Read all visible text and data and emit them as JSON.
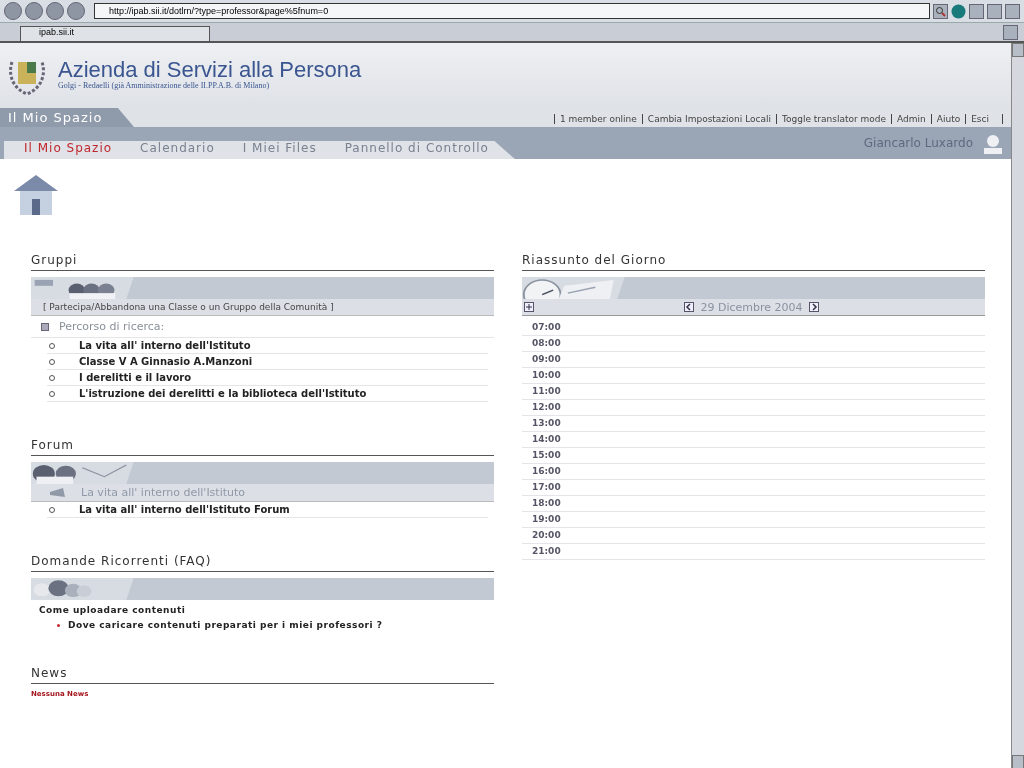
{
  "browser": {
    "url": "http://ipab.sii.it/dotlrn/?type=professor&page%5fnum=0",
    "tab_title": "ipab.sii.it"
  },
  "header": {
    "title": "Azienda di Servizi alla Persona",
    "subtitle": "Golgi - Redaelli (già Amministrazione delle II.PP.A.B. di Milano)"
  },
  "section_tab": "Il Mio Spazio",
  "top_links": [
    "1 member online",
    "Cambia Impostazioni Locali",
    "Toggle translator mode",
    "Admin",
    "Aiuto",
    "Esci"
  ],
  "nav": [
    {
      "label": "Il Mio Spazio",
      "selected": true
    },
    {
      "label": "Calendario",
      "selected": false
    },
    {
      "label": "I Miei Files",
      "selected": false
    },
    {
      "label": "Pannello di Controllo",
      "selected": false
    }
  ],
  "user_name": "Giancarlo Luxardo",
  "gruppi": {
    "title": "Gruppi",
    "action": "[  Partecipa/Abbandona una Classe o un Gruppo della Comunità ]",
    "category": "Percorso di ricerca:",
    "items": [
      "La vita all' interno dell'Istituto",
      "Classe V A Ginnasio A.Manzoni",
      "I derelitti e il lavoro",
      "L'istruzione dei derelitti e la biblioteca dell'Istituto"
    ]
  },
  "forum": {
    "title": "Forum",
    "topic": "La vita all' interno dell'Istituto",
    "items": [
      "La vita all' interno dell'Istituto Forum"
    ]
  },
  "faq": {
    "title": "Domande Ricorrenti (FAQ)",
    "question": "Come uploadare contenuti",
    "items": [
      "Dove caricare contenuti preparati per i miei professori ?"
    ]
  },
  "news": {
    "title": "News",
    "message": "Nessuna News"
  },
  "day_summary": {
    "title": "Riassunto del Giorno",
    "date": "29 Dicembre 2004",
    "hours": [
      "07:00",
      "08:00",
      "09:00",
      "10:00",
      "11:00",
      "12:00",
      "13:00",
      "14:00",
      "15:00",
      "16:00",
      "17:00",
      "18:00",
      "19:00",
      "20:00",
      "21:00"
    ]
  }
}
